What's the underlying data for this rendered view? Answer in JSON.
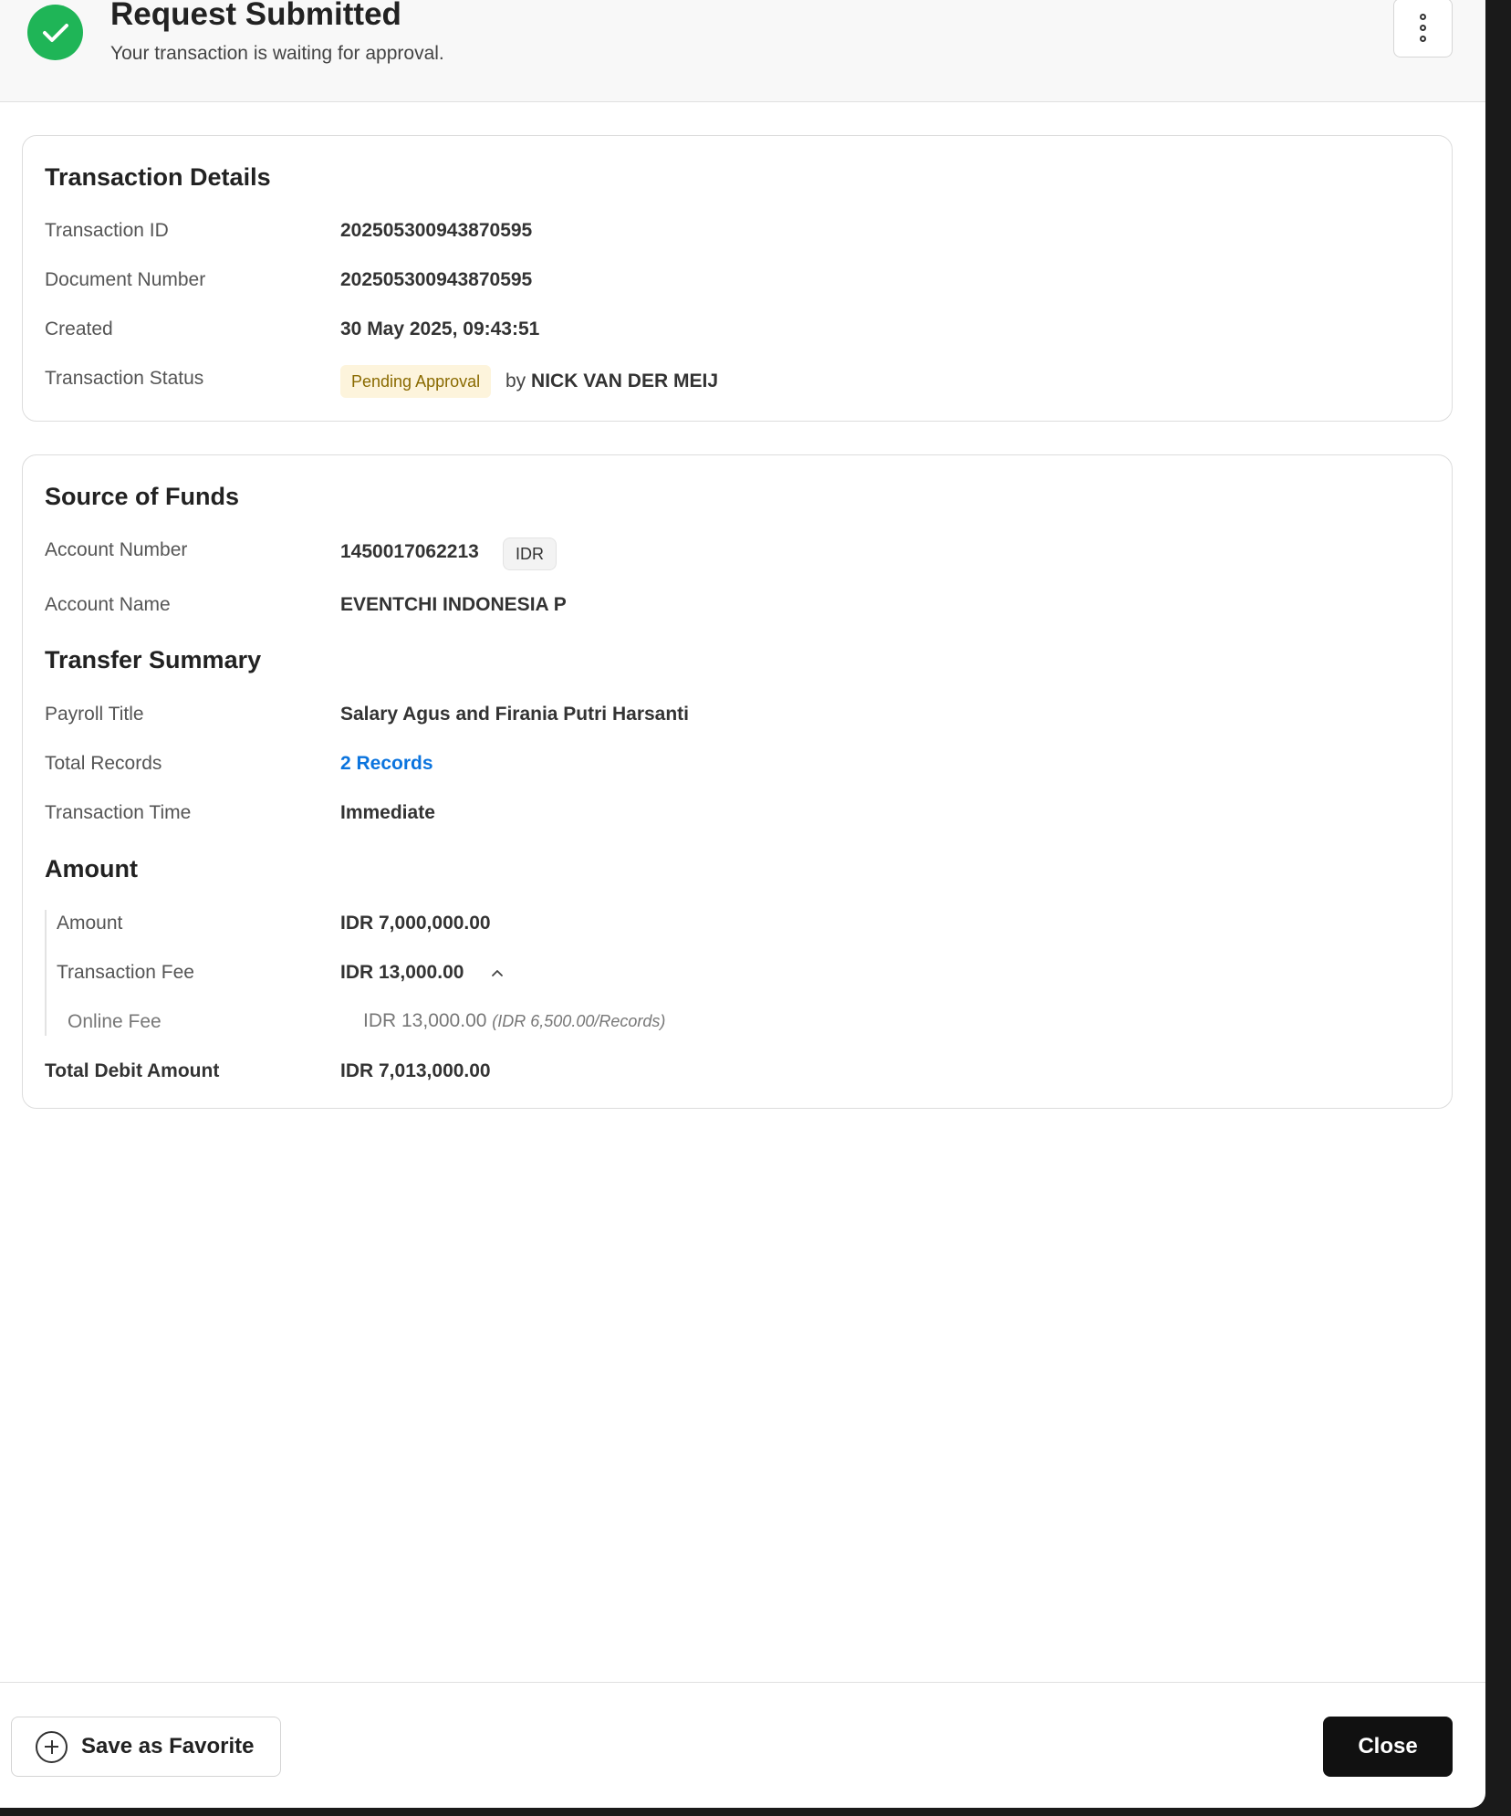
{
  "header": {
    "title": "Request Submitted",
    "subtitle": "Your transaction is waiting for approval.",
    "status_icon": "check-circle-icon",
    "menu_icon": "kebab-menu-icon"
  },
  "transaction_details": {
    "heading": "Transaction Details",
    "rows": [
      {
        "label": "Transaction ID",
        "value": "202505300943870595"
      },
      {
        "label": "Document Number",
        "value": "202505300943870595"
      },
      {
        "label": "Created",
        "value": "30 May 2025, 09:43:51"
      }
    ],
    "status_label": "Transaction Status",
    "status_badge": "Pending Approval",
    "status_by": "by",
    "status_user": "NICK VAN DER MEIJ"
  },
  "source_of_funds": {
    "heading": "Source of Funds",
    "account_number_label": "Account Number",
    "account_number": "1450017062213",
    "currency": "IDR",
    "account_name_label": "Account Name",
    "account_name": "EVENTCHI INDONESIA P"
  },
  "transfer_summary": {
    "heading": "Transfer Summary",
    "payroll_title_label": "Payroll Title",
    "payroll_title": "Salary Agus and Firania Putri Harsanti",
    "total_records_label": "Total Records",
    "total_records": "2 Records",
    "transaction_time_label": "Transaction Time",
    "transaction_time": "Immediate"
  },
  "amount": {
    "heading": "Amount",
    "amount_label": "Amount",
    "amount": "IDR 7,000,000.00",
    "fee_label": "Transaction Fee",
    "fee": "IDR 13,000.00",
    "online_fee_label": "Online Fee",
    "online_fee": "IDR 13,000.00",
    "online_fee_note": "(IDR 6,500.00/Records)",
    "total_label": "Total Debit Amount",
    "total": "IDR 7,013,000.00"
  },
  "footer": {
    "favorite_label": "Save as Favorite",
    "close_label": "Close"
  },
  "colors": {
    "success": "#1fb557",
    "link": "#0b74de",
    "pending_bg": "#fdf4dc",
    "pending_text": "#8a6a00",
    "primary_button": "#111111"
  }
}
